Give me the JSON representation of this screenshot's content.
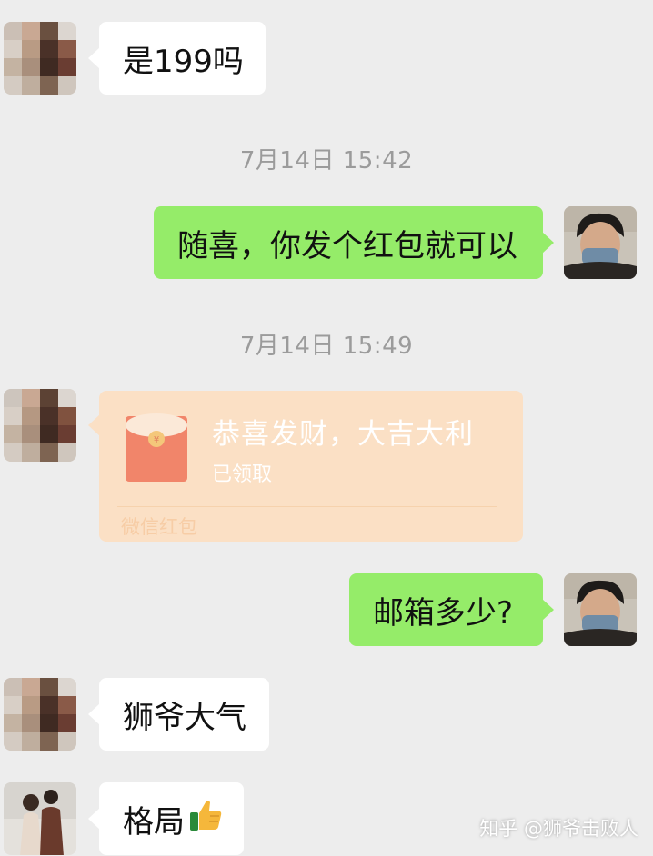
{
  "messages": [
    {
      "text": "是199吗"
    },
    {
      "text": "随喜，你发个红包就可以"
    },
    {
      "text": "邮箱多少?"
    },
    {
      "text": "狮爷大气"
    },
    {
      "text": "格局"
    }
  ],
  "timestamps": [
    "7月14日 15:42",
    "7月14日 15:49"
  ],
  "red_packet": {
    "title": "恭喜发财，大吉大利",
    "status": "已领取",
    "footer": "微信红包",
    "icon": "red-packet-icon"
  },
  "emoji": "thumbs-up-icon",
  "watermark": "知乎 @狮爷击败人",
  "colors": {
    "background": "#ededed",
    "sent_bubble": "#95ec69",
    "received_bubble": "#ffffff",
    "red_packet": "#fbe0c5"
  }
}
